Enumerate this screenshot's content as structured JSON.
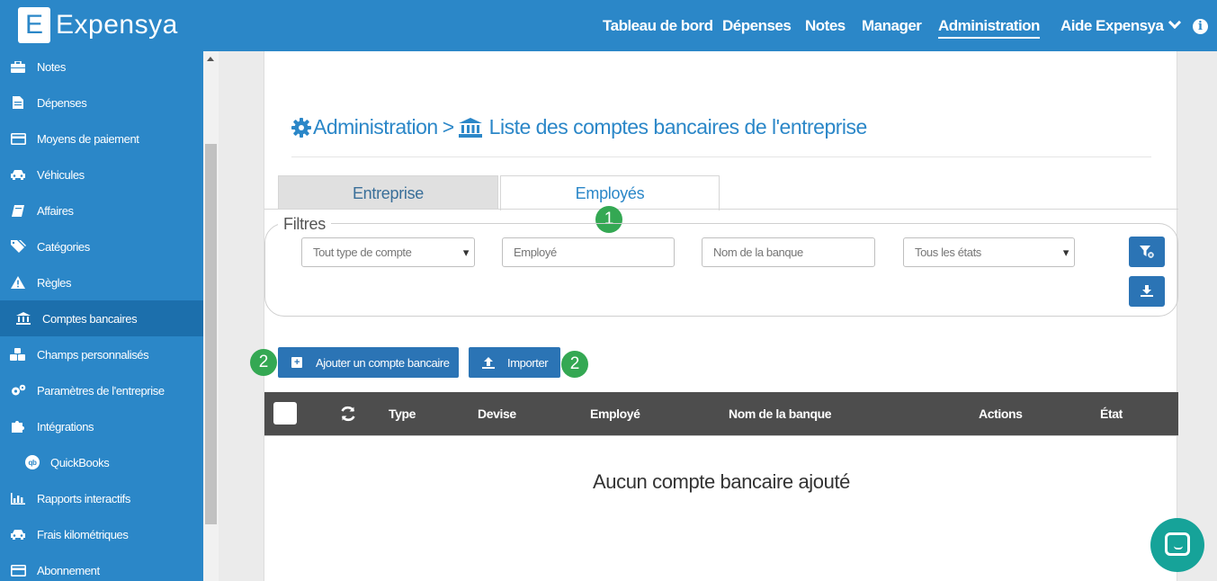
{
  "app": {
    "logo_letter": "E",
    "logo_text": "Expensya"
  },
  "nav": {
    "items": [
      {
        "label": "Tableau de bord"
      },
      {
        "label": "Dépenses"
      },
      {
        "label": "Notes"
      },
      {
        "label": "Manager"
      },
      {
        "label": "Administration"
      }
    ],
    "active_item": "Administration",
    "help_label": "Aide Expensya",
    "info_glyph": "i"
  },
  "sidebar": {
    "items": [
      {
        "label": "Notes",
        "icon": "briefcase-icon"
      },
      {
        "label": "Dépenses",
        "icon": "receipt-icon"
      },
      {
        "label": "Moyens de paiement",
        "icon": "credit-card-icon"
      },
      {
        "label": "Véhicules",
        "icon": "car-icon"
      },
      {
        "label": "Affaires",
        "icon": "book-icon"
      },
      {
        "label": "Catégories",
        "icon": "tags-icon"
      },
      {
        "label": "Règles",
        "icon": "warning-icon"
      },
      {
        "label": "Comptes bancaires",
        "icon": "bank-icon"
      },
      {
        "label": "Champs personnalisés",
        "icon": "cubes-icon"
      },
      {
        "label": "Paramètres de l'entreprise",
        "icon": "cogs-icon"
      },
      {
        "label": "Intégrations",
        "icon": "puzzle-icon"
      },
      {
        "label": "QuickBooks",
        "icon": "quickbooks-icon",
        "badge_text": "qb"
      },
      {
        "label": "Rapports interactifs",
        "icon": "bar-chart-icon"
      },
      {
        "label": "Frais kilométriques",
        "icon": "car-icon"
      },
      {
        "label": "Abonnement",
        "icon": "credit-card-icon"
      }
    ],
    "active_item": "Comptes bancaires"
  },
  "page": {
    "breadcrumb_root": "Administration",
    "breadcrumb_separator": ">",
    "breadcrumb_current": "Liste des comptes bancaires de l'entreprise",
    "tabs": [
      {
        "label": "Entreprise"
      },
      {
        "label": "Employés"
      }
    ],
    "active_tab": "Employés"
  },
  "filters": {
    "legend": "Filtres",
    "account_type": {
      "selected": "Tout type de compte"
    },
    "employee": {
      "placeholder": "Employé"
    },
    "bank_name": {
      "placeholder": "Nom de la banque"
    },
    "state": {
      "selected": "Tous les états"
    }
  },
  "annotations": {
    "badge_1": "1",
    "badge_2a": "2",
    "badge_2b": "2"
  },
  "actions": {
    "add_label": "Ajouter un compte bancaire",
    "import_label": "Importer"
  },
  "table": {
    "columns": [
      "Type",
      "Devise",
      "Employé",
      "Nom de la banque",
      "Actions",
      "État"
    ],
    "empty_message": "Aucun compte bancaire ajouté"
  },
  "colors": {
    "brand_blue": "#2b87c8",
    "button_blue": "#2b74b5",
    "badge_green": "#34a853",
    "chat_teal": "#16a399",
    "table_header": "#4d4d4d"
  }
}
